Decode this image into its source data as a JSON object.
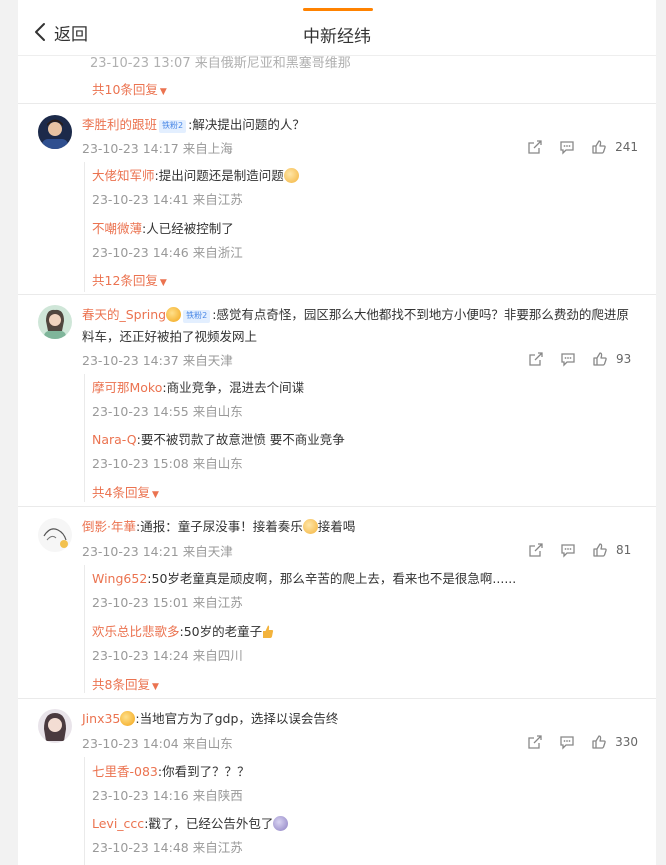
{
  "header": {
    "back_label": "返回",
    "title": "中新经纬"
  },
  "faded_meta": "23-10-23 13:07 来自俄斯尼亚和黑塞哥维那",
  "top_more": "共10条回复",
  "comments": [
    {
      "name": "李胜利的跟班",
      "badge": "铁粉2",
      "text": ":解决提出问题的人？",
      "meta": "23-10-23 14:17 来自上海",
      "likes": "241",
      "replies": [
        {
          "name": "大佬知军师",
          "text": ":提出问题还是制造问题",
          "meta": "23-10-23 14:41 来自江苏"
        },
        {
          "name": "不嘲微薄",
          "text": ":人已经被控制了",
          "meta": "23-10-23 14:46 来自浙江"
        }
      ],
      "more": "共12条回复"
    },
    {
      "name": "春天的_Spring",
      "badge": "铁粉2",
      "text": ":感觉有点奇怪，园区那么大他都找不到地方小便吗？非要那么费劲的爬进原料车，还正好被拍了视频发网上",
      "meta": "23-10-23 14:37 来自天津",
      "likes": "93",
      "replies": [
        {
          "name": "摩可那Moko",
          "text": ":商业竞争，混进去个间谍",
          "meta": "23-10-23 14:55 来自山东"
        },
        {
          "name": "Nara-Q",
          "text": ":要不被罚款了故意泄愤 要不商业竞争",
          "meta": "23-10-23 15:08 来自山东"
        }
      ],
      "more": "共4条回复"
    },
    {
      "name": "倒影·年華",
      "text_a": ":通报：童子尿没事！接着奏乐",
      "text_b": "接着喝",
      "meta": "23-10-23 14:21 来自天津",
      "likes": "81",
      "replies": [
        {
          "name": "Wing652",
          "text": ":50岁老童真是顽皮啊，那么辛苦的爬上去，看来也不是很急啊......",
          "meta": "23-10-23 15:01 来自江苏"
        },
        {
          "name": "欢乐总比悲歌多",
          "text": ":50岁的老童子",
          "meta": "23-10-23 14:24 来自四川"
        }
      ],
      "more": "共8条回复"
    },
    {
      "name": "Jinx35",
      "text": ":当地官方为了gdp，选择以误会告终",
      "meta": "23-10-23 14:04 来自山东",
      "likes": "330",
      "replies": [
        {
          "name": "七里香-083",
          "text": ":你看到了？？？",
          "meta": "23-10-23 14:16 来自陕西"
        },
        {
          "name": "Levi_ccc",
          "text": ":戳了，已经公告外包了",
          "meta": "23-10-23 14:48 来自江苏"
        }
      ]
    }
  ],
  "icons": {
    "back": "chevron-left-icon",
    "share": "share-icon",
    "comment": "comment-icon",
    "like": "thumbs-up-icon"
  },
  "colors": {
    "accent": "#ff8200",
    "name": "#eb7350",
    "meta": "#999999"
  }
}
